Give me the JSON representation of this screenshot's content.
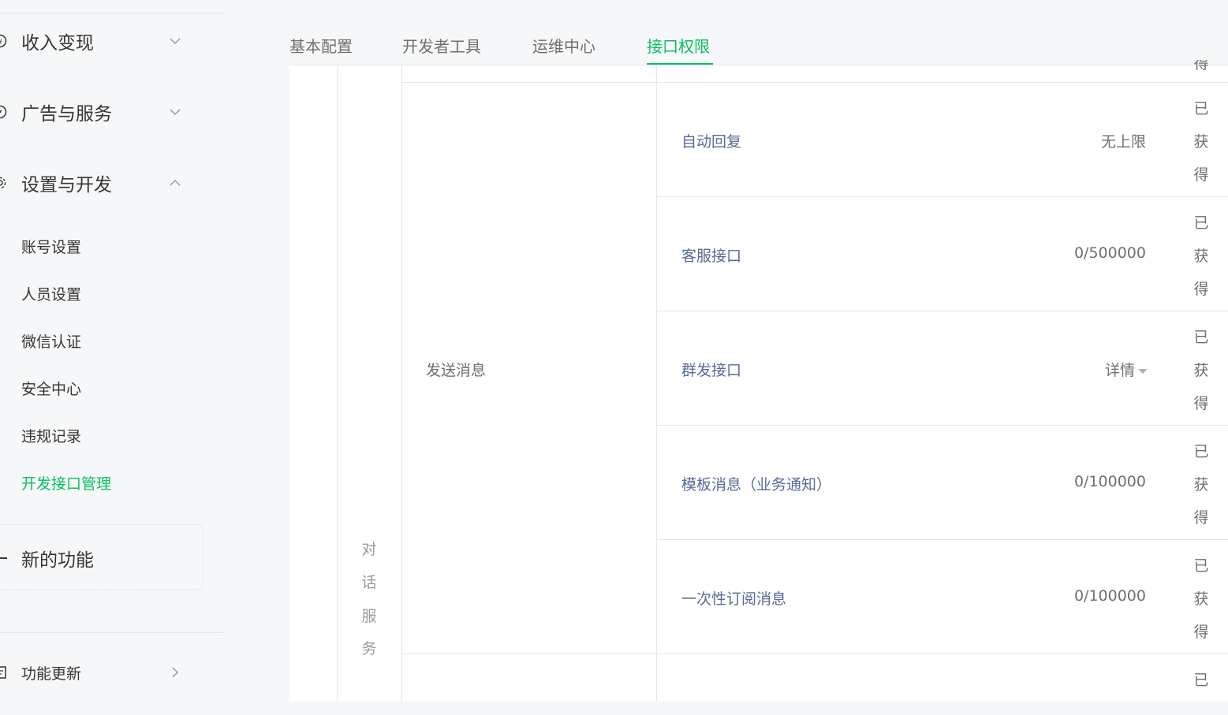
{
  "sidebar": {
    "groups": [
      {
        "label": "收入变现",
        "icon": "coin-icon",
        "expanded": false
      },
      {
        "label": "广告与服务",
        "icon": "compass-icon",
        "expanded": false
      },
      {
        "label": "设置与开发",
        "icon": "gear-icon",
        "expanded": true
      }
    ],
    "items": [
      {
        "label": "账号设置"
      },
      {
        "label": "人员设置"
      },
      {
        "label": "微信认证"
      },
      {
        "label": "安全中心"
      },
      {
        "label": "违规记录"
      },
      {
        "label": "开发接口管理",
        "active": true
      }
    ],
    "new_feature": {
      "label": "新的功能"
    },
    "update": {
      "label": "功能更新"
    }
  },
  "tabs": [
    {
      "label": "基本配置"
    },
    {
      "label": "开发者工具"
    },
    {
      "label": "运维中心"
    },
    {
      "label": "接口权限",
      "active": true
    }
  ],
  "table": {
    "top_status_partial": "得",
    "category": [
      "对",
      "话",
      "服",
      "务"
    ],
    "sub_category": "发送消息",
    "rows": [
      {
        "name": "自动回复",
        "quota": "无上限",
        "status": [
          "已",
          "获",
          "得"
        ]
      },
      {
        "name": "客服接口",
        "quota": "0/500000",
        "status": [
          "已",
          "获",
          "得"
        ]
      },
      {
        "name": "群发接口",
        "quota": "详情",
        "status": [
          "已",
          "获",
          "得"
        ]
      },
      {
        "name": "模板消息（业务通知）",
        "quota": "0/100000",
        "status": [
          "已",
          "获",
          "得"
        ]
      },
      {
        "name": "一次性订阅消息",
        "quota": "0/100000",
        "status": [
          "已",
          "获",
          "得"
        ]
      }
    ],
    "bottom_status_partial": "已"
  },
  "colors": {
    "accent": "#07c160",
    "link": "#576b95",
    "border": "#e7e7eb"
  }
}
